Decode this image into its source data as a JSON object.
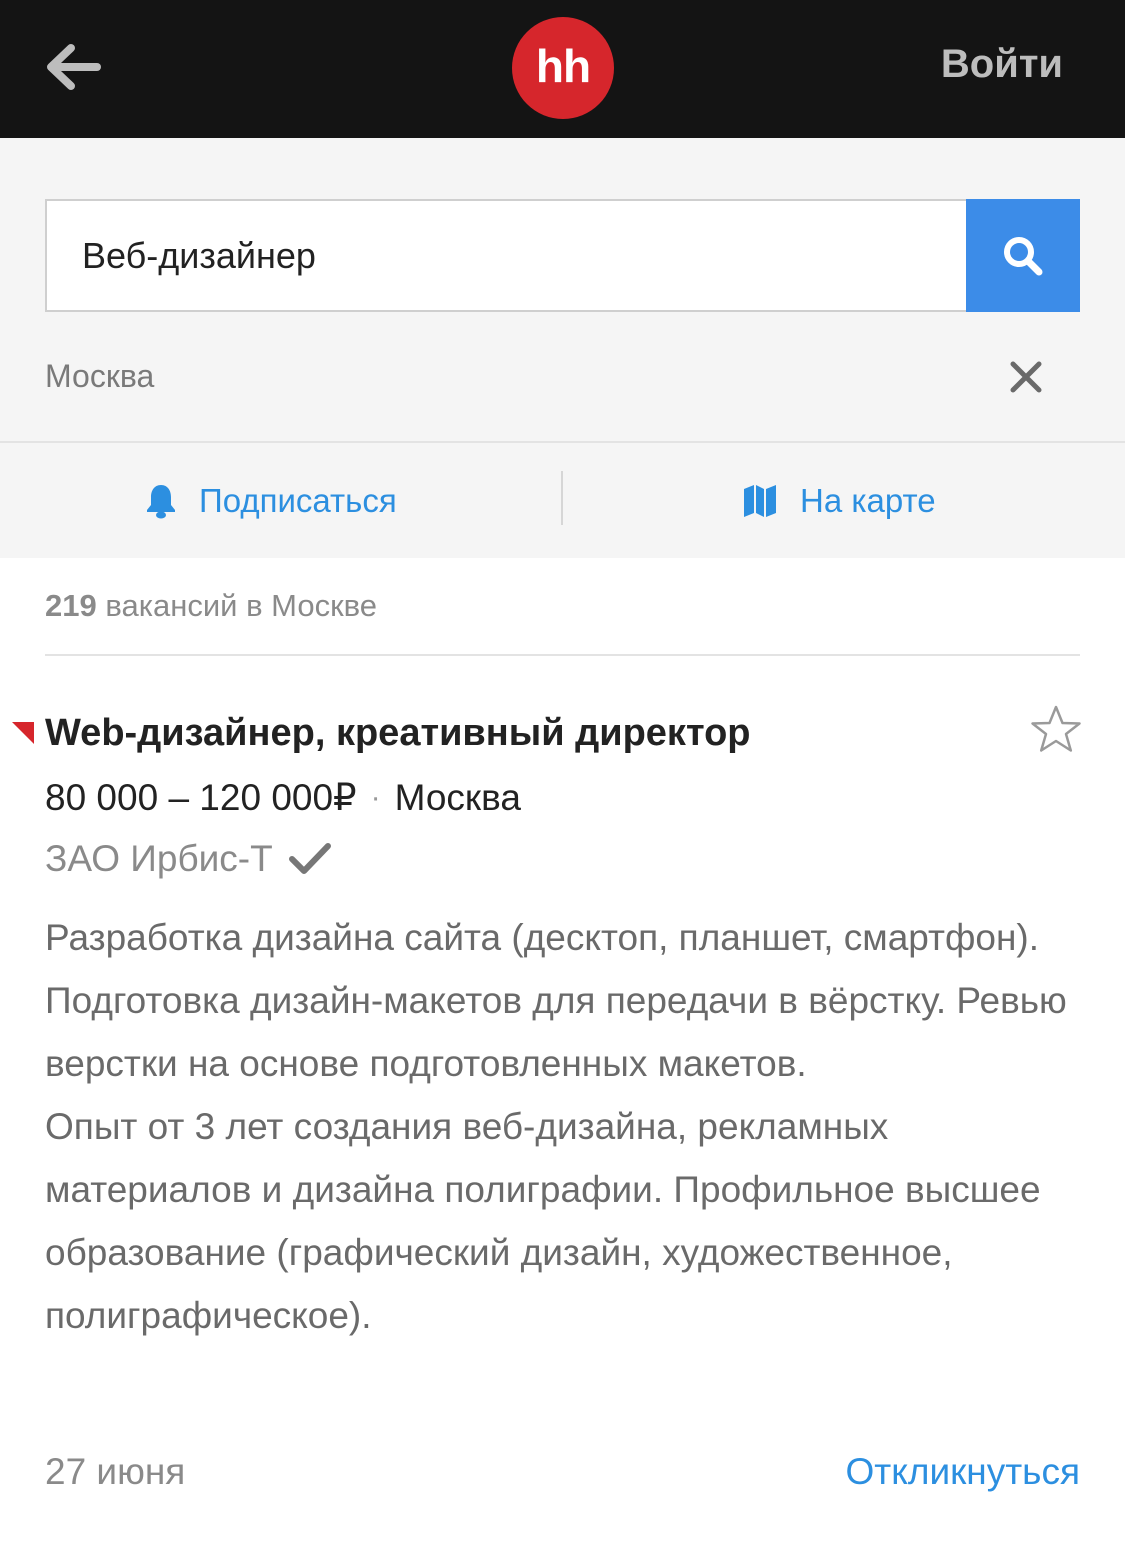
{
  "header": {
    "logo_text": "hh",
    "login_label": "Войти",
    "brand_color": "#d6262c"
  },
  "search": {
    "query": "Веб-дизайнер",
    "region": "Москва",
    "button_color": "#3c8ce8"
  },
  "actions": {
    "subscribe_label": "Подписаться",
    "map_label": "На карте",
    "link_color": "#2c8fe0"
  },
  "results": {
    "count": "219",
    "count_suffix": "вакансий в Москве"
  },
  "vacancy": {
    "title": "Web-дизайнер, креативный директор",
    "salary": "80 000 – 120 000₽",
    "city": "Москва",
    "company": "ЗАО Ирбис-Т",
    "description_1": "Разработка дизайна сайта (десктоп, планшет, смартфон). Подготовка дизайн-макетов для передачи в вёрстку. Ревью верстки на основе подготовленных макетов.",
    "description_2": "Опыт от 3 лет создания веб-дизайна, рекламных материалов и дизайна полиграфии. Профильное высшее образование (графический дизайн, художественное, полиграфическое).",
    "date": "27 июня",
    "respond_label": "Откликнуться"
  },
  "icons": {
    "back": "arrow-left-icon",
    "search": "search-icon",
    "clear": "close-icon",
    "subscribe": "bell-icon",
    "map": "map-icon",
    "favorite": "star-icon",
    "verified": "checkmark-icon"
  }
}
